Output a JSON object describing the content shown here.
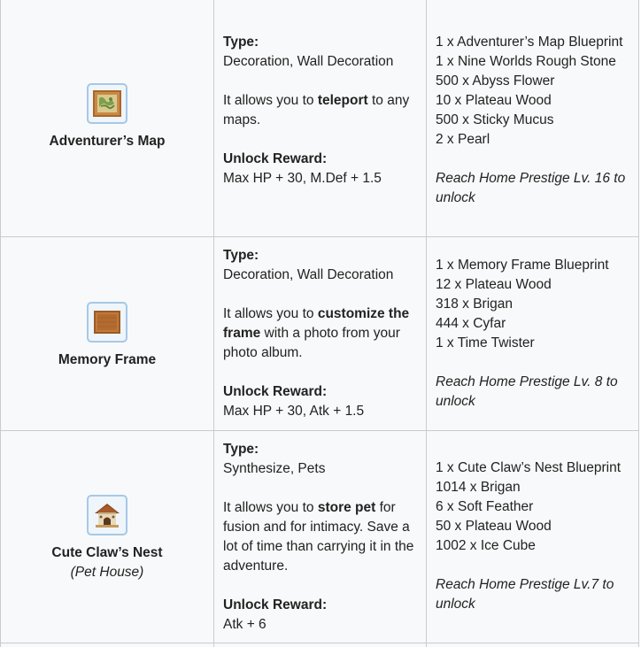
{
  "rows": [
    {
      "name": "Adventurer’s Map",
      "icon": "map-frame-icon",
      "type_label": "Type:",
      "type_value": "Decoration, Wall Decoration",
      "desc_before": "It allows you to ",
      "desc_bold": "teleport",
      "desc_after": " to any maps.",
      "reward_label": "Unlock Reward:",
      "reward_value": "Max HP + 30, M.Def + 1.5",
      "materials": [
        "1 x Adventurer’s Map Blueprint",
        "1 x Nine Worlds Rough Stone",
        "500 x Abyss Flower",
        "10 x Plateau Wood",
        "500 x Sticky Mucus",
        "2 x Pearl"
      ],
      "unlock_note": "Reach Home Prestige Lv. 16 to unlock"
    },
    {
      "name": "Memory Frame",
      "icon": "photo-frame-icon",
      "type_label": "Type:",
      "type_value": "Decoration, Wall Decoration",
      "desc_before": "It allows you to ",
      "desc_bold": "customize the frame",
      "desc_after": " with a photo from your photo album.",
      "reward_label": "Unlock Reward:",
      "reward_value": "Max HP + 30, Atk + 1.5",
      "materials": [
        "1 x Memory Frame Blueprint",
        "12 x Plateau Wood",
        "318 x Brigan",
        "444 x Cyfar",
        "1 x Time Twister"
      ],
      "unlock_note": "Reach Home Prestige Lv. 8 to unlock"
    },
    {
      "name": "Cute Claw’s Nest",
      "subtitle": "(Pet House)",
      "icon": "pet-house-icon",
      "type_label": "Type:",
      "type_value": "Synthesize, Pets",
      "desc_before": "It allows you to ",
      "desc_bold": "store pet",
      "desc_after": " for fusion and for intimacy. Save a lot of time than carrying it in the adventure.",
      "reward_label": "Unlock Reward:",
      "reward_value": "Atk + 6",
      "materials": [
        "1 x Cute Claw’s Nest Blueprint",
        "1014 x Brigan",
        "6 x Soft Feather",
        "50 x Plateau Wood",
        "1002 x Ice Cube"
      ],
      "unlock_note": "Reach Home Prestige Lv.7 to unlock"
    }
  ]
}
